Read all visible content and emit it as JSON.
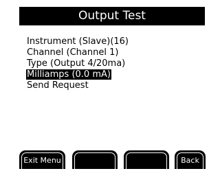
{
  "title": "Output Test",
  "menu": {
    "items": [
      {
        "label": "Instrument (Slave)(16)"
      },
      {
        "label": "Channel (Channel 1)"
      },
      {
        "label": "Type (Output 4/20ma)"
      },
      {
        "label": "Milliamps (0.0 mA)",
        "selected": true
      },
      {
        "label": "Send Request"
      }
    ]
  },
  "softkeys": {
    "k1": "Exit Menu",
    "k2": "",
    "k3": "",
    "k4": "Back"
  },
  "colors": {
    "background": "#ffffff",
    "foreground": "#000000",
    "highlight_bg": "#000000",
    "highlight_fg": "#ffffff"
  }
}
